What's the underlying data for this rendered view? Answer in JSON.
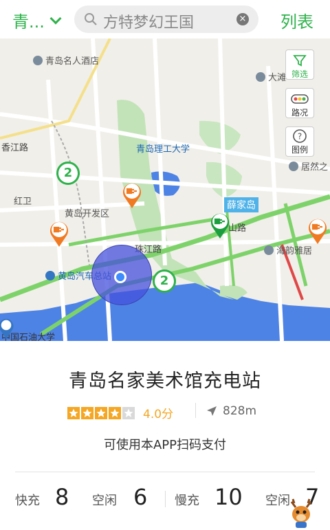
{
  "header": {
    "city": "青...",
    "search_text": "方特梦幻王国",
    "list_label": "列表"
  },
  "map": {
    "labels": {
      "hotel": "青岛名人酒店",
      "dayang": "大滩",
      "qut": "青岛理工大学",
      "xiangjiang": "香江路",
      "juran": "居然之",
      "honggwei": "红卫",
      "huangdao_dev": "黄岛开发区",
      "xuejiadao": "薛家岛",
      "zhujiang": "珠江路",
      "haiyun": "海韵雅居",
      "huangdao_bus": "黄岛汽车总站",
      "petroleum": "中国石油大学",
      "shan_road": "山路"
    },
    "side_buttons": {
      "filter": "筛选",
      "traffic": "路况",
      "legend": "图例"
    },
    "clusters": [
      "2",
      "2"
    ]
  },
  "station": {
    "name": "青岛名家美术馆充电站",
    "rating_value": 4.0,
    "rating_text": "4.0分",
    "distance": "828m",
    "payment_note": "可使用本APP扫码支付",
    "fast_label": "快充",
    "fast_count": "8",
    "fast_free_label": "空闲",
    "fast_free": "6",
    "slow_label": "慢充",
    "slow_count": "10",
    "slow_free_label": "空闲",
    "slow_free": "7"
  },
  "colors": {
    "accent": "#2eb24b",
    "star": "#f5a623",
    "charger_pin": "#f07a22"
  }
}
